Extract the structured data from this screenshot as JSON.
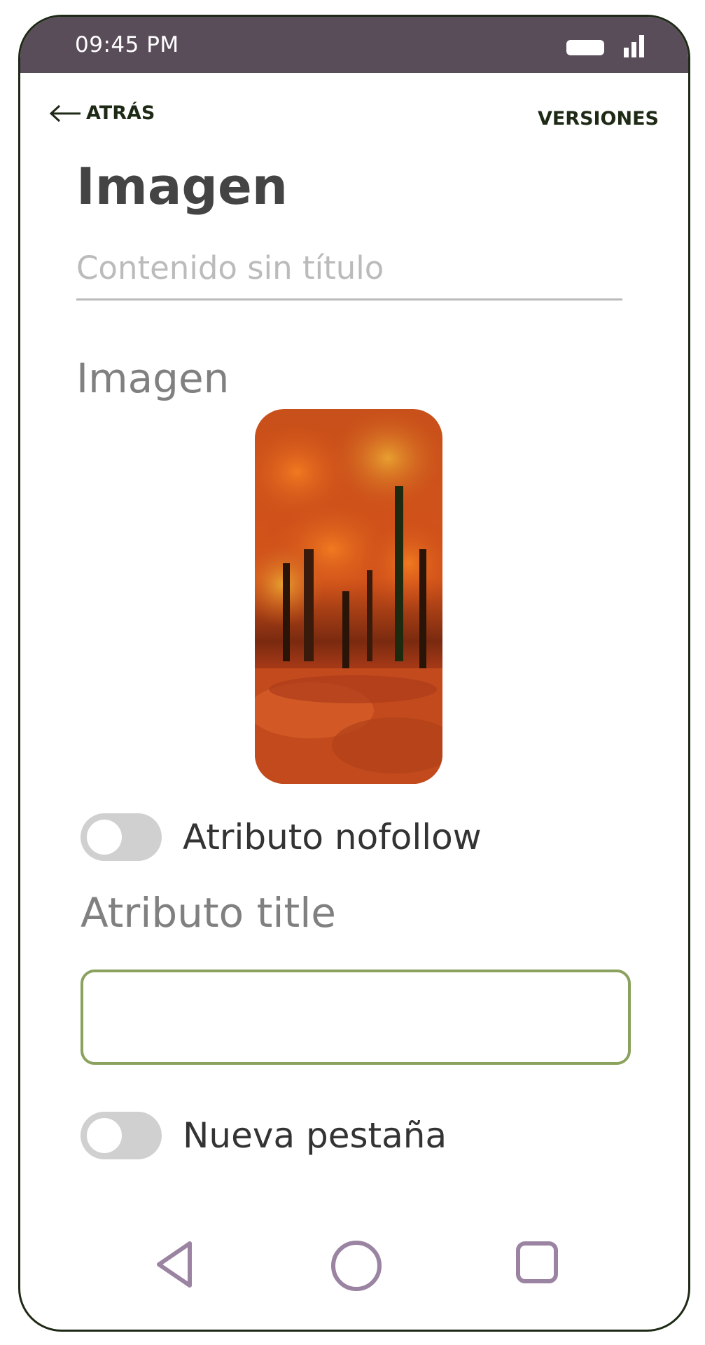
{
  "status_bar": {
    "time": "09:45 PM",
    "battery_icon": "battery-icon",
    "signal_icon": "signal-icon",
    "background": "#5a4d5a"
  },
  "header": {
    "back_label": "ATRÁS",
    "back_icon": "arrow-left-icon",
    "versions_label": "VERSIONES"
  },
  "page": {
    "title": "Imagen",
    "title_input_placeholder": "Contenido sin título",
    "title_input_value": ""
  },
  "image_section": {
    "label": "Imagen",
    "thumbnail": "autumn-forest-image"
  },
  "nofollow": {
    "label": "Atributo nofollow",
    "enabled": false
  },
  "title_attr": {
    "label": "Atributo title",
    "value": "",
    "border_color": "#8aa25e"
  },
  "new_tab": {
    "label": "Nueva pestaña",
    "enabled": false
  },
  "nav_bar": {
    "back_icon": "triangle-back-icon",
    "home_icon": "circle-home-icon",
    "recents_icon": "square-recents-icon",
    "icon_color": "#9a84a2"
  }
}
